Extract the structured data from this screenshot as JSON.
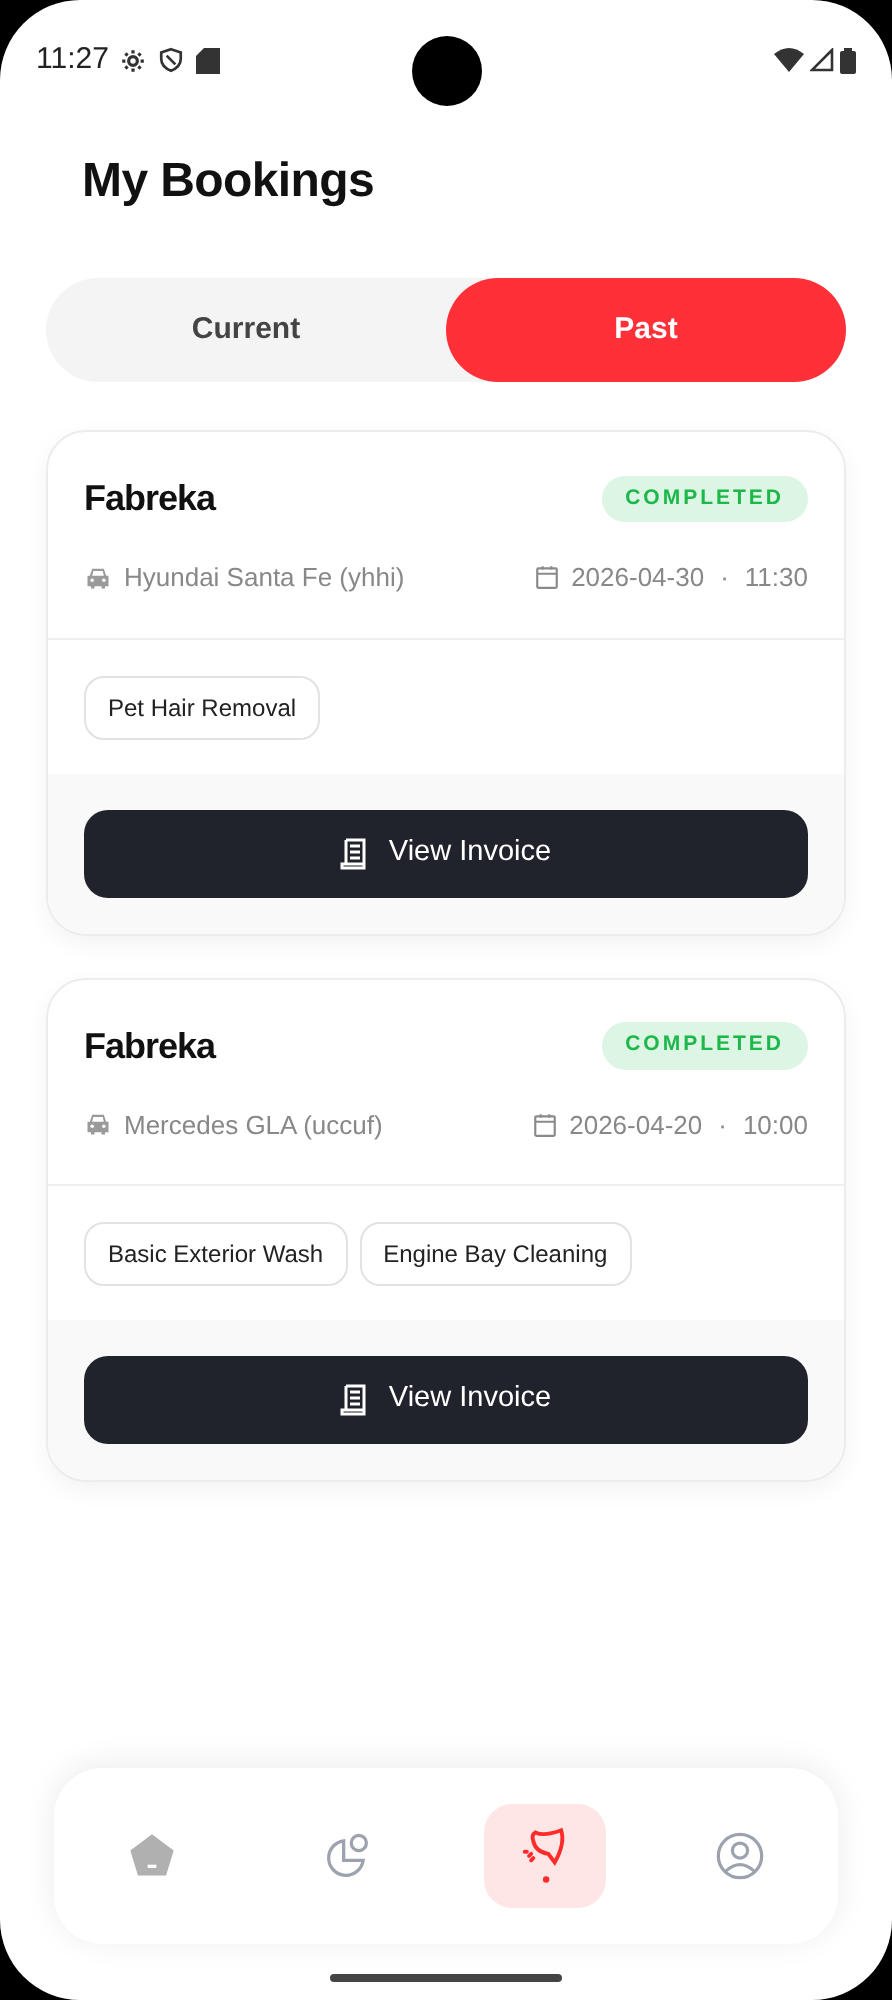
{
  "status_bar": {
    "time": "11:27"
  },
  "title": "My Bookings",
  "tabs": [
    {
      "label": "Current",
      "selected": false
    },
    {
      "label": "Past",
      "selected": true
    }
  ],
  "bookings": [
    {
      "provider": "Fabreka",
      "status": "COMPLETED",
      "vehicle": "Hyundai Santa Fe (yhhi)",
      "date": "2026-04-30",
      "separator": "·",
      "time": "11:30",
      "services": [
        "Pet Hair Removal"
      ],
      "action": "View Invoice"
    },
    {
      "provider": "Fabreka",
      "status": "COMPLETED",
      "vehicle": "Mercedes GLA (uccuf)",
      "date": "2026-04-20",
      "separator": "·",
      "time": "10:00",
      "services": [
        "Basic Exterior Wash",
        "Engine Bay Cleaning"
      ],
      "action": "View Invoice"
    }
  ],
  "nav": [
    {
      "kind": "home",
      "selected": false
    },
    {
      "kind": "stats",
      "selected": false
    },
    {
      "kind": "bookings",
      "selected": true
    },
    {
      "kind": "profile",
      "selected": false
    }
  ]
}
